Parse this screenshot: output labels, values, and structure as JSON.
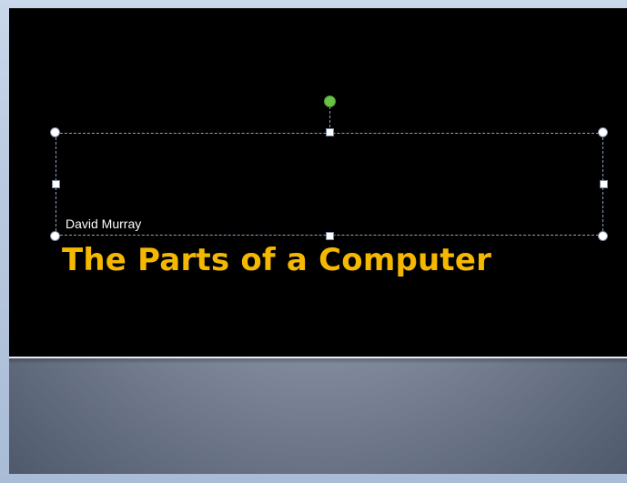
{
  "slide": {
    "subtitle": "David Murray",
    "title": "The Parts of a Computer"
  },
  "colors": {
    "slide_background": "#000000",
    "title_color": "#f5b800",
    "subtitle_color": "#ffffff",
    "rotate_handle": "#6cc04a",
    "selection_border": "#8da2c0"
  },
  "selection": {
    "rotate_handle_icon": "rotate-handle-icon",
    "resize_handle_icon": "resize-handle-icon"
  }
}
